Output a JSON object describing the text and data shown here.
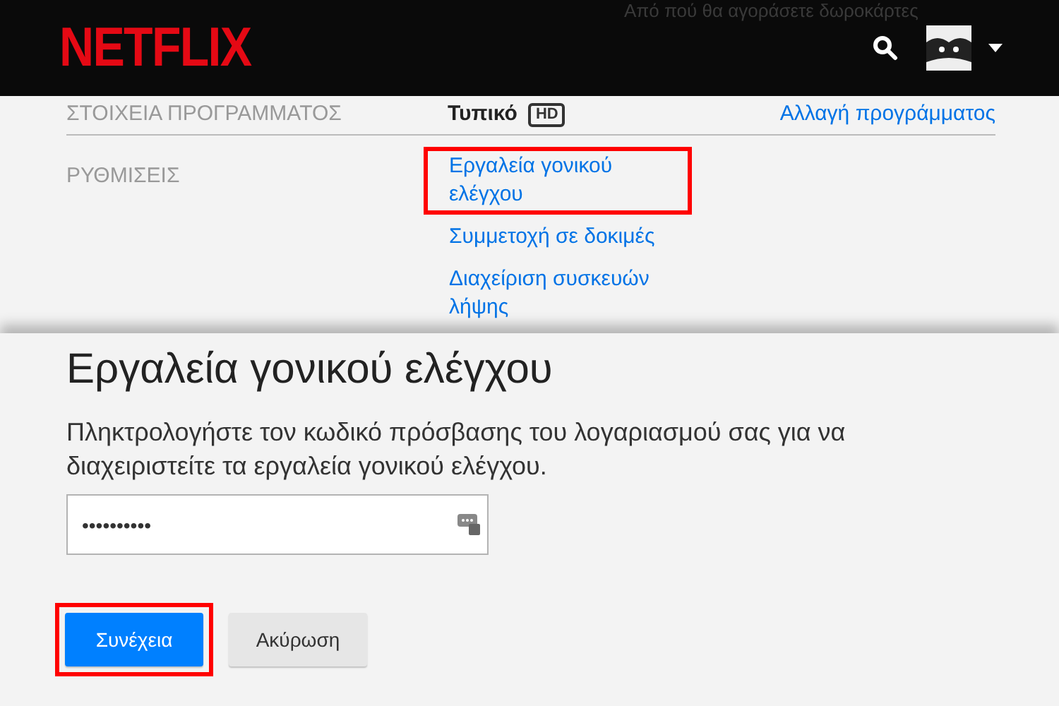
{
  "header": {
    "logo": "NETFLIX",
    "top_text": "Από πού θα αγοράσετε δωροκάρτες"
  },
  "plan_row": {
    "label": "ΣΤΟΙΧΕΙΑ ΠΡΟΓΡΑΜΜΑΤΟΣ",
    "plan": "Τυπικό",
    "badge": "HD",
    "link": "Αλλαγή προγράμματος"
  },
  "settings": {
    "label": "ΡΥΘΜΙΣΕΙΣ",
    "links": [
      {
        "text": "Εργαλεία γονικού ελέγχου",
        "highlighted": true
      },
      {
        "text": "Συμμετοχή σε δοκιμές",
        "highlighted": false
      },
      {
        "text": "Διαχείριση συσκευών λήψης",
        "highlighted": false
      }
    ]
  },
  "dialog": {
    "title": "Εργαλεία γονικού ελέγχου",
    "message": "Πληκτρολογήστε τον κωδικό πρόσβασης του λογαριασμού σας για να διαχειριστείτε τα εργαλεία γονικού ελέγχου.",
    "password": {
      "value": "••••••••••"
    },
    "buttons": [
      {
        "label": "Συνέχεια",
        "kind": "primary",
        "highlighted": true
      },
      {
        "label": "Ακύρωση",
        "kind": "secondary",
        "highlighted": false
      }
    ]
  }
}
